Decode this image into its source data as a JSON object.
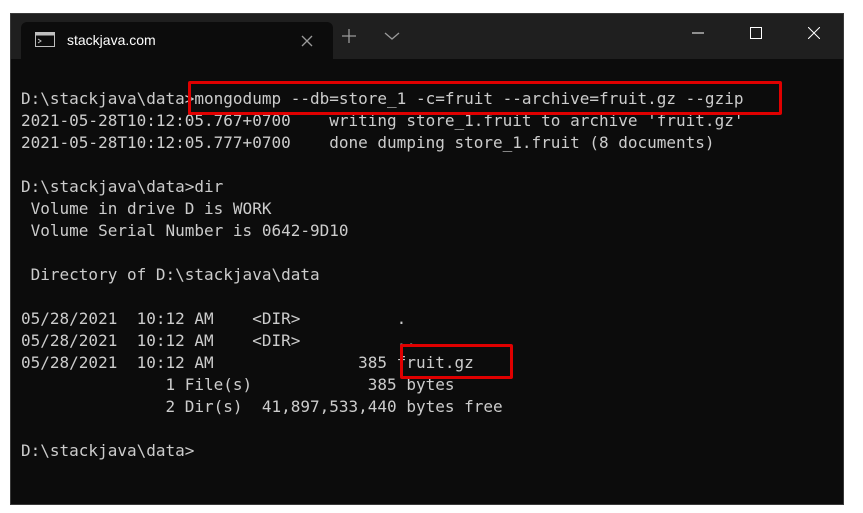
{
  "window": {
    "tab_title": "stackjava.com",
    "icons": {
      "tab": "terminal-icon",
      "close_tab": "close-icon",
      "new_tab": "plus-icon",
      "dropdown": "chevron-down-icon",
      "minimize": "minimize-icon",
      "maximize": "maximize-icon",
      "close": "close-icon"
    }
  },
  "terminal": {
    "lines": [
      "",
      "D:\\stackjava\\data>mongodump --db=store_1 -c=fruit --archive=fruit.gz --gzip",
      "2021-05-28T10:12:05.767+0700    writing store_1.fruit to archive 'fruit.gz'",
      "2021-05-28T10:12:05.777+0700    done dumping store_1.fruit (8 documents)",
      "",
      "D:\\stackjava\\data>dir",
      " Volume in drive D is WORK",
      " Volume Serial Number is 0642-9D10",
      "",
      " Directory of D:\\stackjava\\data",
      "",
      "05/28/2021  10:12 AM    <DIR>          .",
      "05/28/2021  10:12 AM    <DIR>          ..",
      "05/28/2021  10:12 AM               385 fruit.gz",
      "               1 File(s)            385 bytes",
      "               2 Dir(s)  41,897,533,440 bytes free",
      "",
      "D:\\stackjava\\data>"
    ]
  },
  "colors": {
    "terminal_bg": "#0c0c0c",
    "text": "#cccccc",
    "titlebar_bg": "#1f1f1f",
    "highlight": "#e00000"
  }
}
